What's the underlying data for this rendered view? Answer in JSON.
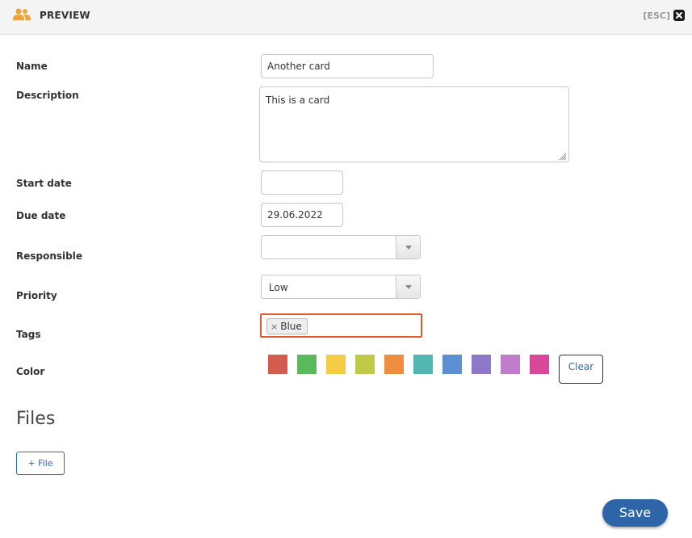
{
  "header": {
    "title": "PREVIEW",
    "esc_label": "[ESC]",
    "icon": "users-icon",
    "close_icon": "close-icon"
  },
  "form": {
    "name": {
      "label": "Name",
      "value": "Another card"
    },
    "description": {
      "label": "Description",
      "value": "This is a card"
    },
    "start_date": {
      "label": "Start date",
      "value": ""
    },
    "due_date": {
      "label": "Due date",
      "value": "29.06.2022"
    },
    "responsible": {
      "label": "Responsible",
      "value": ""
    },
    "priority": {
      "label": "Priority",
      "value": "Low"
    },
    "tags": {
      "label": "Tags",
      "items": [
        "Blue"
      ],
      "remove_glyph": "×"
    },
    "color": {
      "label": "Color",
      "swatches": [
        "#d45c4f",
        "#5cb85c",
        "#f4cd45",
        "#bfcb46",
        "#ee8c3f",
        "#52b7b0",
        "#5b8fd2",
        "#8e78c9",
        "#c17ccc",
        "#d9479a"
      ],
      "clear_label": "Clear"
    }
  },
  "files": {
    "heading": "Files",
    "add_file_label": "+ File"
  },
  "actions": {
    "save_label": "Save"
  },
  "colors": {
    "accent": "#2e64a8",
    "focus_border": "#e2592a",
    "header_icon": "#f0a33a"
  }
}
